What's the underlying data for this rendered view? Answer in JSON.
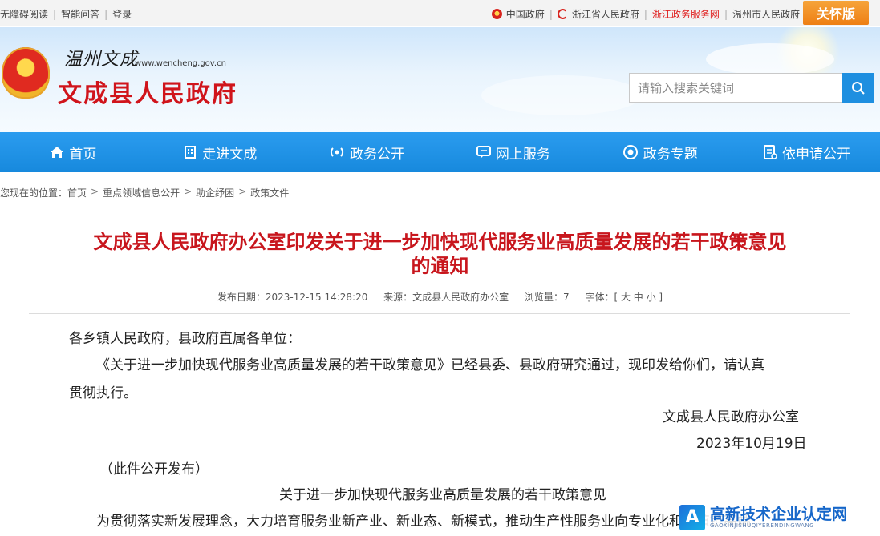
{
  "topbar": {
    "left_links": [
      "无障碍阅读",
      "智能问答",
      "登录"
    ],
    "right_links": [
      "中国政府",
      "浙江省人民政府",
      "浙江政务服务网",
      "温州市人民政府"
    ],
    "care_button": "关怀版"
  },
  "header": {
    "calligraphy": "温州文成",
    "url": "www.wencheng.gov.cn",
    "site_title": "文成县人民政府",
    "search_placeholder": "请输入搜索关键词"
  },
  "nav": {
    "items": [
      {
        "label": "首页",
        "icon": "home-icon"
      },
      {
        "label": "走进文成",
        "icon": "building-icon"
      },
      {
        "label": "政务公开",
        "icon": "broadcast-icon"
      },
      {
        "label": "网上服务",
        "icon": "chat-icon"
      },
      {
        "label": "政务专题",
        "icon": "eye-icon"
      },
      {
        "label": "依申请公开",
        "icon": "document-icon"
      }
    ]
  },
  "breadcrumb": {
    "prefix": "您现在的位置：",
    "items": [
      "首页",
      "重点领域信息公开",
      "助企纾困",
      "政策文件"
    ]
  },
  "article": {
    "title_line1": "文成县人民政府办公室印发关于进一步加快现代服务业高质量发展的若干政策意见",
    "title_line2": "的通知",
    "publish_date": "发布日期：2023-12-15 14:28:20",
    "source": "来源：文成县人民政府办公室",
    "views": "浏览量：7",
    "font_size": "字体：[ 大 中 小 ]",
    "salutation": "各乡镇人民政府，县政府直属各单位：",
    "para1_line1": "《关于进一步加快现代服务业高质量发展的若干政策意见》已经县委、县政府研究通过，现印发给你们，请认真",
    "para1_line2": "贯彻执行。",
    "signature": "文成县人民政府办公室",
    "date": "2023年10月19日",
    "publish_note": "（此件公开发布）",
    "subtitle": "关于进一步加快现代服务业高质量发展的若干政策意见",
    "para2_start": "为贯彻落实新发展理念，大力培育服务业新产业、新业态、新模式，推动生产性服务业向专业化和价值链高端"
  },
  "watermark": {
    "main": "高新技术企业认定网",
    "sub": "GAOXINJISHUQIYERENDINGWANG"
  },
  "colors": {
    "nav_blue": "#1789dd",
    "title_red": "#c8161d",
    "care_orange": "#ee7f14"
  }
}
